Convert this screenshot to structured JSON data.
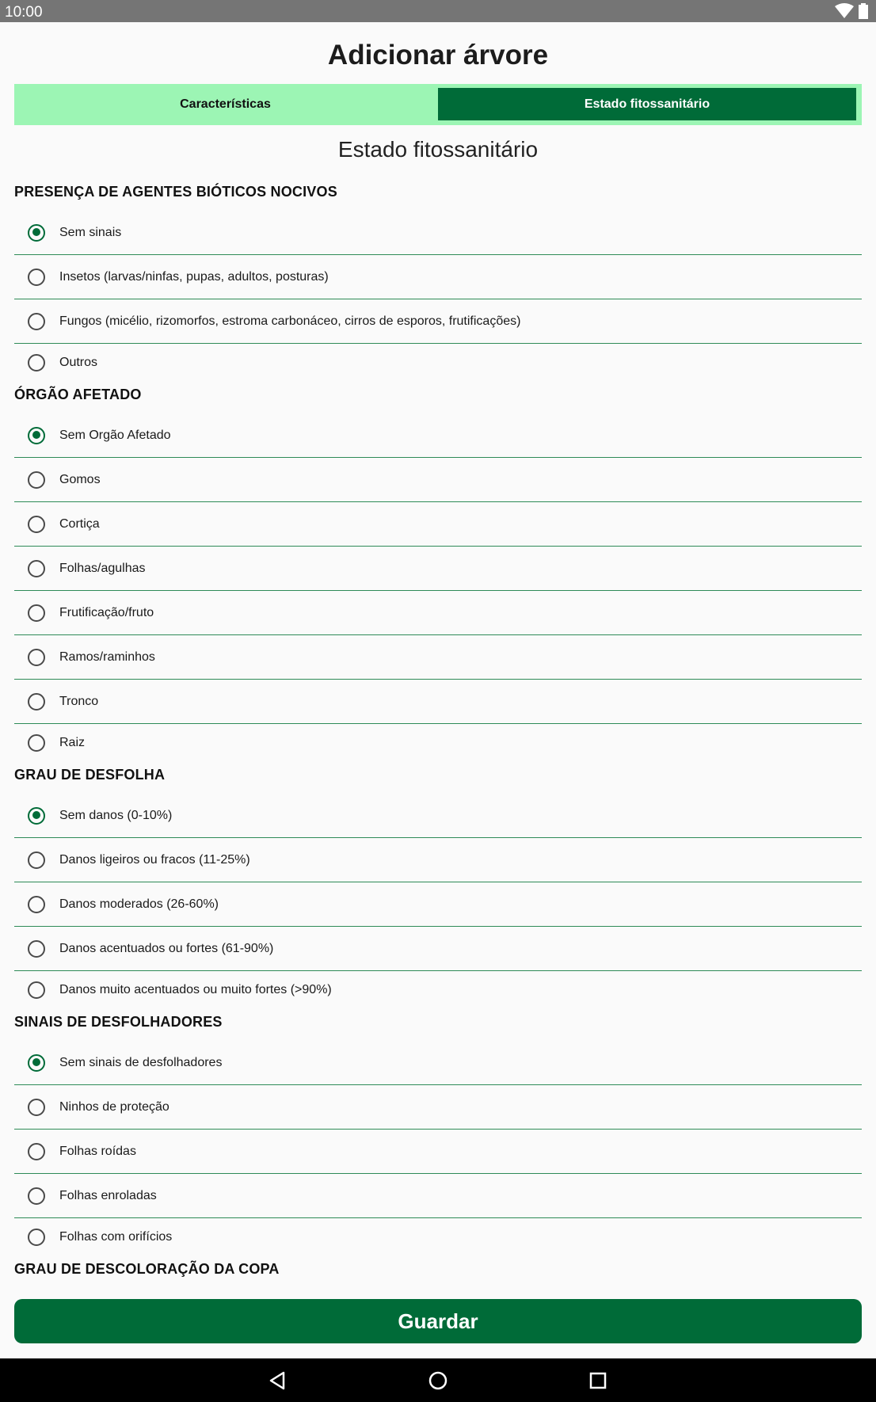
{
  "status_bar": {
    "time": "10:00"
  },
  "page_title": "Adicionar árvore",
  "tabs": [
    {
      "label": "Características",
      "active": false
    },
    {
      "label": "Estado fitossanitário",
      "active": true
    }
  ],
  "section_heading": "Estado fitossanitário",
  "groups": [
    {
      "title": "PRESENÇA DE AGENTES BIÓTICOS NOCIVOS",
      "options": [
        {
          "label": "Sem sinais",
          "selected": true
        },
        {
          "label": "Insetos (larvas/ninfas, pupas, adultos, posturas)",
          "selected": false
        },
        {
          "label": "Fungos (micélio, rizomorfos, estroma carbonáceo, cirros de esporos, frutificações)",
          "selected": false
        },
        {
          "label": "Outros",
          "selected": false
        }
      ]
    },
    {
      "title": "ÓRGÃO AFETADO",
      "options": [
        {
          "label": "Sem Orgão Afetado",
          "selected": true
        },
        {
          "label": "Gomos",
          "selected": false
        },
        {
          "label": "Cortiça",
          "selected": false
        },
        {
          "label": "Folhas/agulhas",
          "selected": false
        },
        {
          "label": "Frutificação/fruto",
          "selected": false
        },
        {
          "label": "Ramos/raminhos",
          "selected": false
        },
        {
          "label": "Tronco",
          "selected": false
        },
        {
          "label": "Raiz",
          "selected": false
        }
      ]
    },
    {
      "title": "GRAU DE DESFOLHA",
      "options": [
        {
          "label": "Sem danos (0-10%)",
          "selected": true
        },
        {
          "label": "Danos ligeiros ou fracos (11-25%)",
          "selected": false
        },
        {
          "label": "Danos moderados (26-60%)",
          "selected": false
        },
        {
          "label": "Danos acentuados ou fortes (61-90%)",
          "selected": false
        },
        {
          "label": "Danos muito acentuados ou muito fortes (>90%)",
          "selected": false
        }
      ]
    },
    {
      "title": "SINAIS DE DESFOLHADORES",
      "options": [
        {
          "label": "Sem sinais de desfolhadores",
          "selected": true
        },
        {
          "label": "Ninhos de proteção",
          "selected": false
        },
        {
          "label": "Folhas roídas",
          "selected": false
        },
        {
          "label": "Folhas enroladas",
          "selected": false
        },
        {
          "label": "Folhas com orifícios",
          "selected": false
        }
      ]
    },
    {
      "title": "GRAU DE DESCOLORAÇÃO DA COPA",
      "options": []
    }
  ],
  "save_label": "Guardar",
  "colors": {
    "primary": "#006b38",
    "tab_bg": "#9cf5b4",
    "divider": "#2e8b57"
  },
  "icons": {
    "status": [
      "wifi-icon",
      "battery-icon"
    ],
    "nav": [
      "back-icon",
      "home-icon",
      "recents-icon"
    ]
  }
}
